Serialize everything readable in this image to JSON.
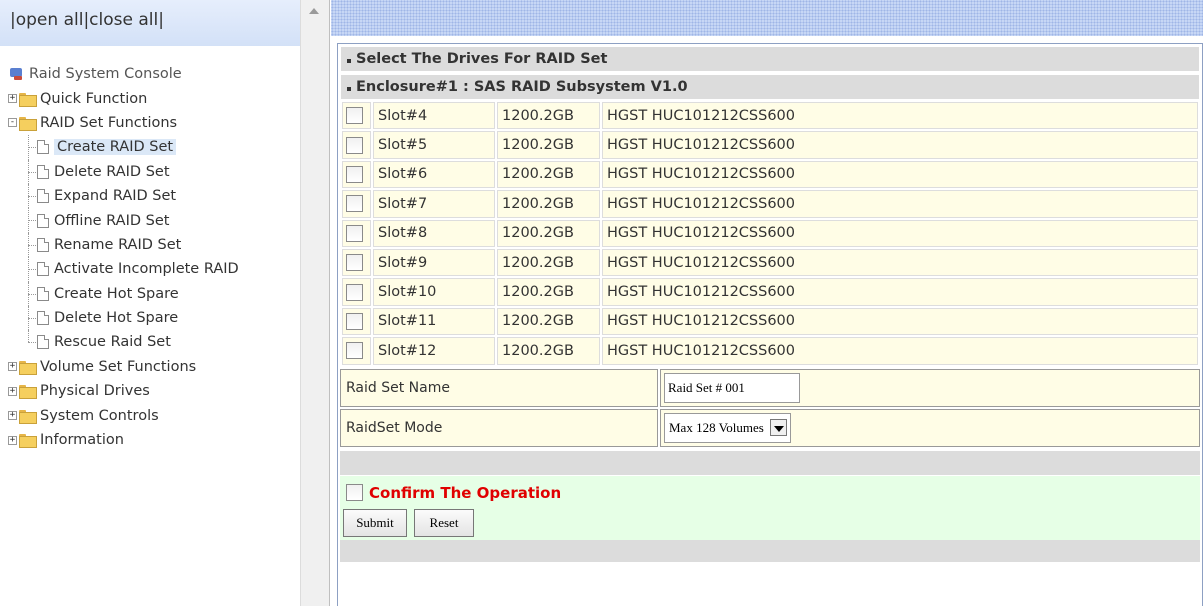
{
  "left_header": {
    "prefix": "|",
    "open_all": "open all",
    "sep": "|",
    "close_all": "close all",
    "suffix": "|"
  },
  "tree": {
    "root": "Raid System Console",
    "groups": [
      {
        "label": "Quick Function",
        "expander": "+"
      },
      {
        "label": "RAID Set Functions",
        "expander": "-"
      },
      {
        "label": "Volume Set Functions",
        "expander": "+"
      },
      {
        "label": "Physical Drives",
        "expander": "+"
      },
      {
        "label": "System Controls",
        "expander": "+"
      },
      {
        "label": "Information",
        "expander": "+"
      }
    ],
    "raid_items": [
      "Create RAID Set",
      "Delete RAID Set",
      "Expand RAID Set",
      "Offline RAID Set",
      "Rename RAID Set",
      "Activate Incomplete RAID",
      "Create Hot Spare",
      "Delete Hot Spare",
      "Rescue Raid Set"
    ],
    "selected": "Create RAID Set"
  },
  "main": {
    "header1": "Select The Drives For RAID Set",
    "header2": "Enclosure#1 : SAS RAID Subsystem V1.0",
    "drives": [
      {
        "slot": "Slot#4",
        "size": "1200.2GB",
        "model": "HGST HUC101212CSS600"
      },
      {
        "slot": "Slot#5",
        "size": "1200.2GB",
        "model": "HGST HUC101212CSS600"
      },
      {
        "slot": "Slot#6",
        "size": "1200.2GB",
        "model": "HGST HUC101212CSS600"
      },
      {
        "slot": "Slot#7",
        "size": "1200.2GB",
        "model": "HGST HUC101212CSS600"
      },
      {
        "slot": "Slot#8",
        "size": "1200.2GB",
        "model": "HGST HUC101212CSS600"
      },
      {
        "slot": "Slot#9",
        "size": "1200.2GB",
        "model": "HGST HUC101212CSS600"
      },
      {
        "slot": "Slot#10",
        "size": "1200.2GB",
        "model": "HGST HUC101212CSS600"
      },
      {
        "slot": "Slot#11",
        "size": "1200.2GB",
        "model": "HGST HUC101212CSS600"
      },
      {
        "slot": "Slot#12",
        "size": "1200.2GB",
        "model": "HGST HUC101212CSS600"
      }
    ],
    "raid_set_name_label": "Raid Set Name",
    "raid_set_name_value": "Raid Set # 001",
    "raid_mode_label": "RaidSet Mode",
    "raid_mode_value": "Max 128 Volumes",
    "confirm_label": "Confirm The Operation",
    "submit_label": "Submit",
    "reset_label": "Reset"
  }
}
